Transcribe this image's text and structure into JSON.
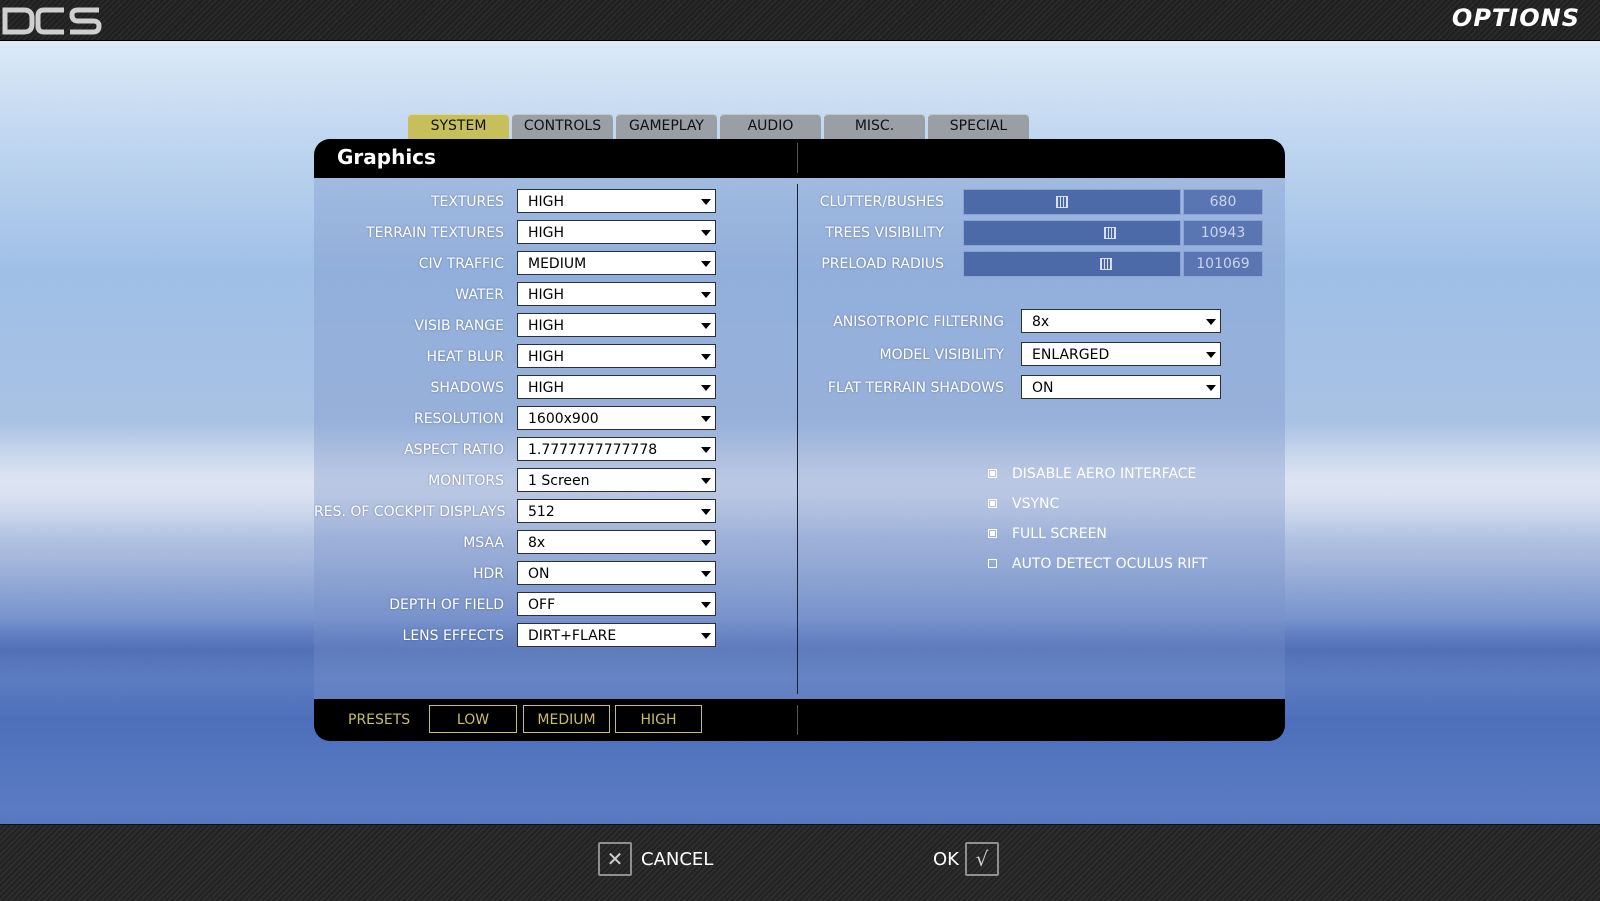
{
  "header": {
    "logo_text": "DCS",
    "title": "OPTIONS"
  },
  "tabs": [
    {
      "label": "SYSTEM",
      "active": true
    },
    {
      "label": "CONTROLS",
      "active": false
    },
    {
      "label": "GAMEPLAY",
      "active": false
    },
    {
      "label": "AUDIO",
      "active": false
    },
    {
      "label": "MISC.",
      "active": false
    },
    {
      "label": "SPECIAL",
      "active": false
    }
  ],
  "panel": {
    "title": "Graphics"
  },
  "left_settings": [
    {
      "label": "TEXTURES",
      "value": "HIGH"
    },
    {
      "label": "TERRAIN TEXTURES",
      "value": "HIGH"
    },
    {
      "label": "CIV TRAFFIC",
      "value": "MEDIUM"
    },
    {
      "label": "WATER",
      "value": "HIGH"
    },
    {
      "label": "VISIB RANGE",
      "value": "HIGH"
    },
    {
      "label": "HEAT BLUR",
      "value": "HIGH"
    },
    {
      "label": "SHADOWS",
      "value": "HIGH"
    },
    {
      "label": "RESOLUTION",
      "value": "1600x900"
    },
    {
      "label": "ASPECT RATIO",
      "value": "1.7777777777778"
    },
    {
      "label": "MONITORS",
      "value": "1 Screen"
    },
    {
      "label": "RES. OF COCKPIT DISPLAYS",
      "value": "512"
    },
    {
      "label": "MSAA",
      "value": "8x"
    },
    {
      "label": "HDR",
      "value": "ON"
    },
    {
      "label": "DEPTH OF FIELD",
      "value": "OFF"
    },
    {
      "label": "LENS EFFECTS",
      "value": "DIRT+FLARE"
    }
  ],
  "sliders": [
    {
      "label": "CLUTTER/BUSHES",
      "value": "680",
      "fraction": 0.45
    },
    {
      "label": "TREES VISIBILITY",
      "value": "10943",
      "fraction": 0.67
    },
    {
      "label": "PRELOAD RADIUS",
      "value": "101069",
      "fraction": 0.65
    }
  ],
  "right_settings": [
    {
      "label": "ANISOTROPIC FILTERING",
      "value": "8x"
    },
    {
      "label": "MODEL VISIBILITY",
      "value": "ENLARGED"
    },
    {
      "label": "FLAT TERRAIN SHADOWS",
      "value": "ON"
    }
  ],
  "checkboxes": [
    {
      "label": "DISABLE AERO INTERFACE",
      "checked": true
    },
    {
      "label": "VSYNC",
      "checked": true
    },
    {
      "label": "FULL SCREEN",
      "checked": true
    },
    {
      "label": "AUTO DETECT OCULUS RIFT",
      "checked": false
    }
  ],
  "presets": {
    "label": "PRESETS",
    "buttons": [
      "LOW",
      "MEDIUM",
      "HIGH"
    ]
  },
  "footer": {
    "cancel_label": "CANCEL",
    "ok_label": "OK",
    "cancel_icon": "✕",
    "ok_icon": "√"
  },
  "colors": {
    "active_tab": "#c7bf5a",
    "tab": "#9a9fa6",
    "preset_accent": "#c8bd6a"
  }
}
